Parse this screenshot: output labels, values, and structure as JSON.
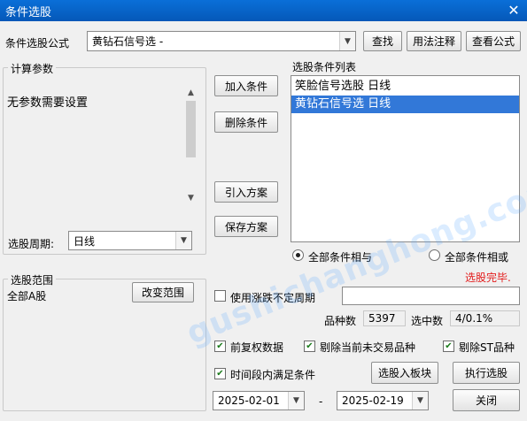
{
  "window": {
    "title": "条件选股",
    "close_glyph": "✕"
  },
  "formula": {
    "label": "条件选股公式",
    "value": "黄钻石信号选  -",
    "buttons": {
      "find": "查找",
      "usage": "用法注释",
      "view": "查看公式"
    }
  },
  "params": {
    "legend": "计算参数",
    "message": "无参数需要设置",
    "period_label": "选股周期:",
    "period_value": "日线"
  },
  "actions": {
    "add": "加入条件",
    "remove": "删除条件",
    "import": "引入方案",
    "save": "保存方案"
  },
  "conditions": {
    "legend": "选股条件列表",
    "items": [
      {
        "label": "笑脸信号选股  日线",
        "selected": false
      },
      {
        "label": "黄钻石信号选  日线",
        "selected": true
      }
    ],
    "radio_and": "全部条件相与",
    "radio_or": "全部条件相或"
  },
  "status": {
    "text": "选股完毕.",
    "color": "#e31b1b"
  },
  "range": {
    "legend": "选股范围",
    "value": "全部A股",
    "change_button": "改变范围"
  },
  "options": {
    "use_unstable_period": "使用涨跌不定周期",
    "stock_count_label": "品种数",
    "stock_count": "5397",
    "selected_label": "选中数",
    "selected_value": "4/0.1%",
    "forward_adjust": "前复权数据",
    "exclude_no_trade": "剔除当前未交易品种",
    "exclude_st": "剔除ST品种",
    "time_range": "时间段内满足条件"
  },
  "dates": {
    "start": "2025-02-01",
    "separator": "-",
    "end": "2025-02-19"
  },
  "bottom_buttons": {
    "to_block": "选股入板块",
    "execute": "执行选股",
    "close": "关闭"
  },
  "watermark": "gushichanghong.com"
}
